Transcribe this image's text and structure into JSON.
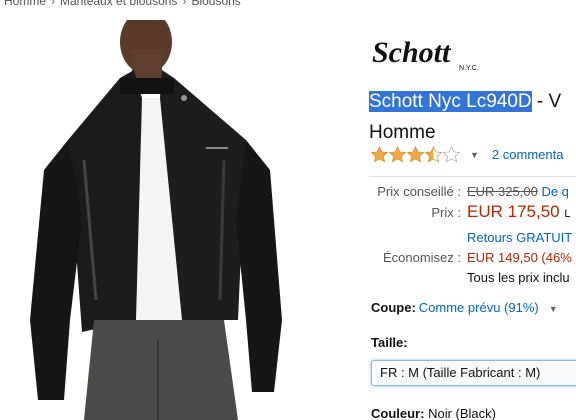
{
  "breadcrumb": {
    "items": [
      "Homme",
      "Manteaux et blousons",
      "Blousons"
    ],
    "sep": "›"
  },
  "brand": {
    "logo_text": "Schott",
    "logo_sub": "N.Y.C."
  },
  "product": {
    "title_highlight": "Schott Nyc Lc940D",
    "title_rest": " - V",
    "subtitle": "Homme"
  },
  "rating": {
    "value": 3.5,
    "out_of": 5,
    "reviews_label": "2 commenta",
    "star_color": "#f3a847"
  },
  "prices": {
    "list_label": "Prix conseillé :",
    "list_value": "EUR 325,00",
    "list_extra": "De q",
    "price_label": "Prix :",
    "price_value": "EUR 175,50",
    "price_suffix": "L",
    "returns": "Retours GRATUIT",
    "save_label": "Économisez :",
    "save_value": "EUR 149,50 (46%",
    "tax_note": "Tous les prix inclu"
  },
  "coupe": {
    "label": "Coupe:",
    "value": "Comme prévu (91%)"
  },
  "size": {
    "label": "Taille:",
    "selected": "FR : M (Taille Fabricant : M)"
  },
  "color": {
    "label": "Couleur:",
    "value": "Noir (Black)"
  },
  "colors": {
    "link": "#0066c0",
    "price": "#b12704",
    "highlight": "#3375d6"
  }
}
